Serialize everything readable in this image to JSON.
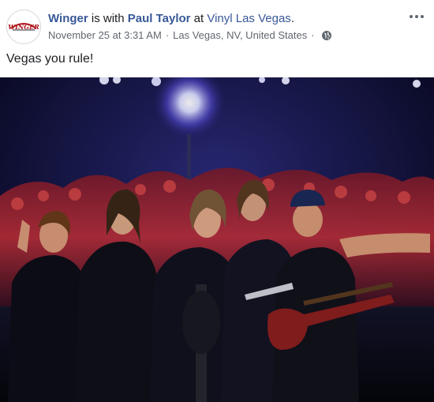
{
  "post": {
    "author": "Winger",
    "connector_with": "is with",
    "tagged": "Paul Taylor",
    "connector_at": "at",
    "place": "Vinyl Las Vegas",
    "period": ".",
    "timestamp": "November 25 at 3:31 AM",
    "separator": "·",
    "location": "Las Vegas, NV, United States",
    "privacy_icon": "globe-icon",
    "menu_icon": "more-options-icon",
    "body_text": "Vegas you rule!",
    "avatar_logo_text": "WINGER"
  },
  "colors": {
    "link": "#385898",
    "secondary_text": "#616770",
    "primary_text": "#1c1e21",
    "stage_dark": "#0a0b1e",
    "crowd_red": "#c2303a"
  }
}
